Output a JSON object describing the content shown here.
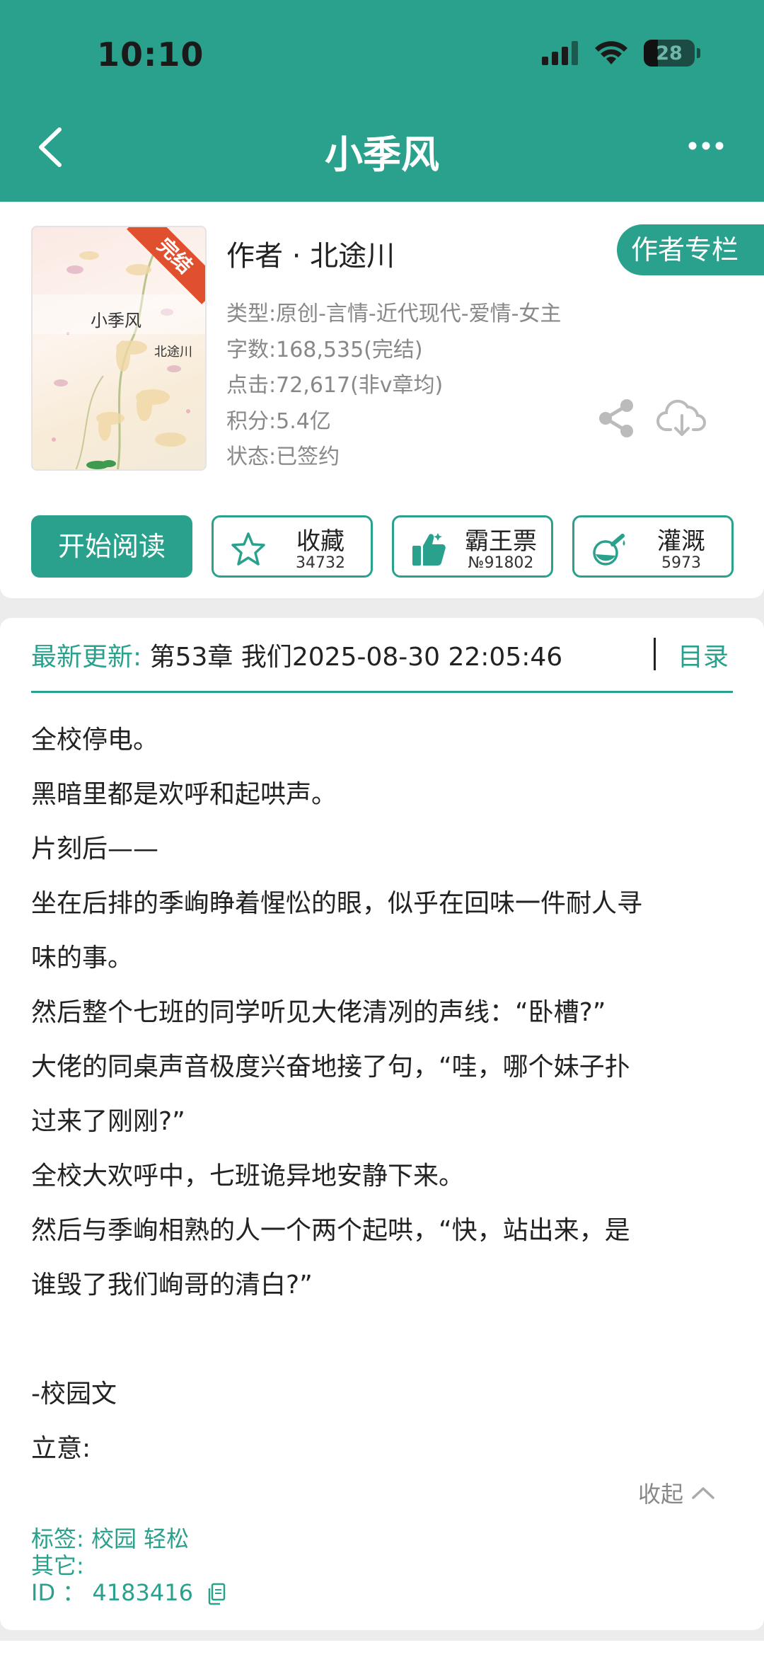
{
  "status_bar": {
    "time": "10:10",
    "battery": "28",
    "battery_level_percent": 28
  },
  "nav": {
    "title": "小季风",
    "back_icon": "chevron-left-icon",
    "more_icon": "more-horizontal-icon"
  },
  "book": {
    "cover_title": "小季风",
    "cover_author": "北途川",
    "cover_badge": "完结",
    "author_line": "作者 · 北途川",
    "author_column_button": "作者专栏",
    "meta": {
      "genre": "类型:原创-言情-近代现代-爱情-女主",
      "words": "字数:168,535(完结)",
      "clicks": "点击:72,617(非v章均)",
      "points": "积分:5.4亿",
      "status": "状态:已签约"
    }
  },
  "actions": {
    "read": "开始阅读",
    "favorite": {
      "label": "收藏",
      "count": "34732",
      "icon": "star-icon"
    },
    "vote": {
      "label": "霸王票",
      "count": "№91802",
      "icon": "thumbs-up-icon"
    },
    "water": {
      "label": "灌溉",
      "count": "5973",
      "icon": "nutrient-flask-icon"
    }
  },
  "latest": {
    "label": "最新更新:",
    "text": " 第53章 我们2025-08-30 22:05:46",
    "toc": "目录"
  },
  "description": [
    "全校停电。",
    "黑暗里都是欢呼和起哄声。",
    "片刻后——",
    "坐在后排的季峋睁着惺忪的眼，似乎在回味一件耐人寻",
    "味的事。",
    "然后整个七班的同学听见大佬清冽的声线：“卧槽?”",
    "大佬的同桌声音极度兴奋地接了句，“哇，哪个妹子扑",
    "过来了刚刚?”",
    "全校大欢呼中，七班诡异地安静下来。",
    "然后与季峋相熟的人一个两个起哄，“快，站出来，是",
    "谁毁了我们峋哥的清白?”",
    "",
    "-校园文",
    "立意:"
  ],
  "collapse": "收起",
  "tags": {
    "tags_line": "标签: 校园  轻松",
    "other_line": "其它:",
    "id_line": "ID  ：  4183416"
  },
  "colors": {
    "accent": "#2aa18d",
    "badge": "#e0502e"
  }
}
